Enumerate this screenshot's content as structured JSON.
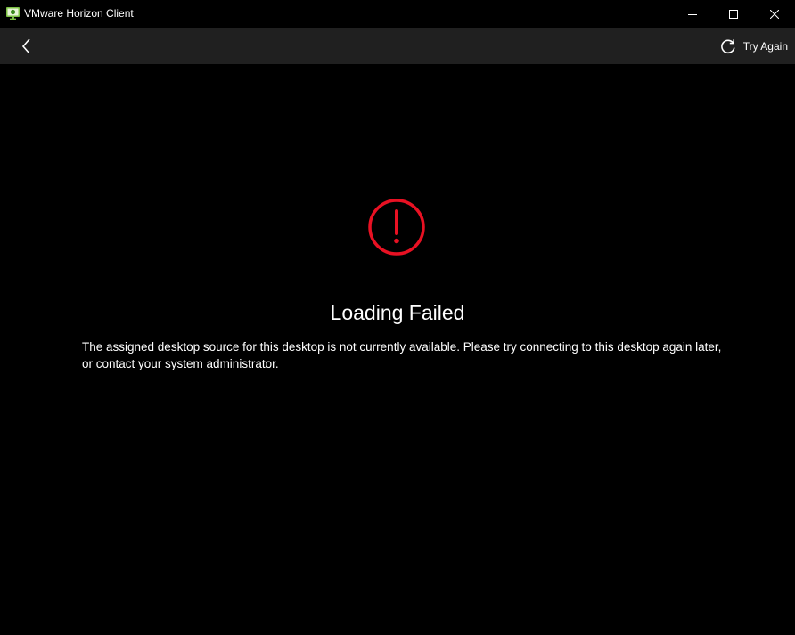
{
  "window": {
    "title": "VMware Horizon Client",
    "icon": "vmware-horizon-icon",
    "controls": {
      "minimize": "minimize-icon",
      "maximize": "maximize-icon",
      "close": "close-icon"
    }
  },
  "appbar": {
    "back_icon": "chevron-left-icon",
    "try_again_icon": "refresh-icon",
    "try_again_label": "Try Again"
  },
  "error": {
    "icon": "error-circle-icon",
    "icon_color": "#e81123",
    "title": "Loading Failed",
    "message": "The assigned desktop source for this desktop is not currently available. Please try connecting to this desktop again later, or contact your system administrator."
  },
  "colors": {
    "background": "#000000",
    "appbar": "#202020",
    "text": "#ffffff"
  }
}
